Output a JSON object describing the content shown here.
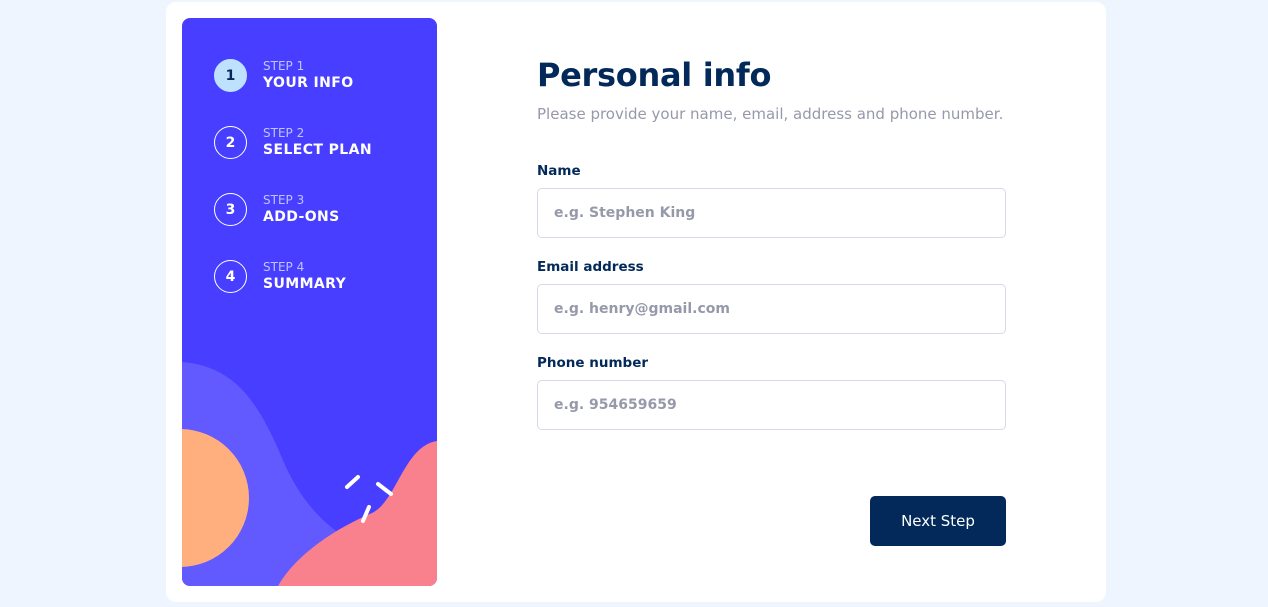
{
  "sidebar": {
    "steps": [
      {
        "number": "1",
        "label": "STEP 1",
        "title": "YOUR INFO",
        "active": true
      },
      {
        "number": "2",
        "label": "STEP 2",
        "title": "SELECT PLAN",
        "active": false
      },
      {
        "number": "3",
        "label": "STEP 3",
        "title": "ADD-ONS",
        "active": false
      },
      {
        "number": "4",
        "label": "STEP 4",
        "title": "SUMMARY",
        "active": false
      }
    ]
  },
  "main": {
    "title": "Personal info",
    "subtitle": "Please provide your name, email, address and phone number.",
    "fields": {
      "name": {
        "label": "Name",
        "value": "",
        "placeholder": "e.g. Stephen King"
      },
      "email": {
        "label": "Email address",
        "value": "",
        "placeholder": "e.g. henry@gmail.com"
      },
      "phone": {
        "label": "Phone number",
        "value": "",
        "placeholder": "e.g. 954659659"
      }
    },
    "next_label": "Next Step"
  },
  "colors": {
    "page_background": "#eff5ff",
    "sidebar_purple": "#483eff",
    "active_step": "#bee2fd",
    "marine_blue": "#022959",
    "cool_gray": "#9699aa",
    "border": "#d6d9e6",
    "wave_purple": "#6259ff",
    "blob_orange": "#ffaf7e",
    "blob_pink": "#f9818e"
  }
}
